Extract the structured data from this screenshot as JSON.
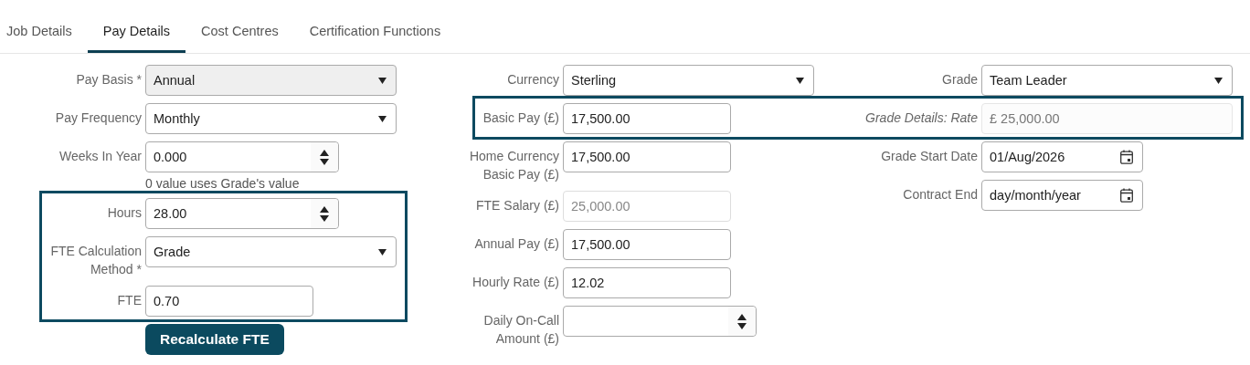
{
  "tabs": [
    {
      "label": "Job Details",
      "selected": false
    },
    {
      "label": "Pay Details",
      "selected": true
    },
    {
      "label": "Cost Centres",
      "selected": false
    },
    {
      "label": "Certification Functions",
      "selected": false
    }
  ],
  "columns": [
    {
      "rows": [
        {
          "label": "Pay Basis *",
          "kind": "select",
          "value": "Annual",
          "disabled": true,
          "highlighted": false
        },
        {
          "label": "Pay Frequency",
          "kind": "select",
          "value": "Monthly",
          "disabled": false,
          "highlighted": false
        },
        {
          "label": "Weeks In Year",
          "kind": "number",
          "value": "0.000",
          "hint": "0 value uses Grade's value",
          "disabled": false,
          "highlighted": false
        },
        {
          "label": "Hours",
          "kind": "number",
          "value": "28.00",
          "disabled": false,
          "highlighted": true
        },
        {
          "label": "FTE Calculation Method *",
          "kind": "select",
          "value": "Grade",
          "disabled": false,
          "highlighted": true
        },
        {
          "label": "FTE",
          "kind": "text",
          "value": "0.70",
          "disabled": false,
          "highlighted": true
        }
      ],
      "button": {
        "label": "Recalculate FTE"
      }
    },
    {
      "rows": [
        {
          "label": "Currency",
          "kind": "select",
          "value": "Sterling",
          "disabled": false,
          "highlighted": false
        },
        {
          "label": "Basic Pay (£)",
          "kind": "text",
          "value": "17,500.00",
          "disabled": false,
          "highlighted": true
        },
        {
          "label": "Home Currency Basic Pay (£)",
          "kind": "text",
          "value": "17,500.00",
          "disabled": false,
          "highlighted": false
        },
        {
          "label": "FTE Salary (£)",
          "kind": "text",
          "value": "25,000.00",
          "disabled": true,
          "highlighted": false
        },
        {
          "label": "Annual Pay (£)",
          "kind": "text",
          "value": "17,500.00",
          "disabled": false,
          "highlighted": false
        },
        {
          "label": "Hourly Rate (£)",
          "kind": "text",
          "value": "12.02",
          "disabled": false,
          "highlighted": false
        },
        {
          "label": "Daily On-Call Amount (£)",
          "kind": "number",
          "disabled": false,
          "highlighted": false
        }
      ]
    },
    {
      "rows": [
        {
          "label": "Grade",
          "kind": "select",
          "value": "Team Leader",
          "disabled": false,
          "highlighted": false
        },
        {
          "label": "Grade Details: Rate",
          "kind": "readonly",
          "value": "£ 25,000.00",
          "disabled": false,
          "highlighted": true
        },
        {
          "label": "Grade Start Date",
          "kind": "date",
          "value": "01/Aug/2026",
          "disabled": false,
          "highlighted": false
        },
        {
          "label": "Contract End",
          "kind": "date",
          "placeholder": "day/month/year",
          "disabled": false,
          "highlighted": false
        }
      ]
    }
  ]
}
